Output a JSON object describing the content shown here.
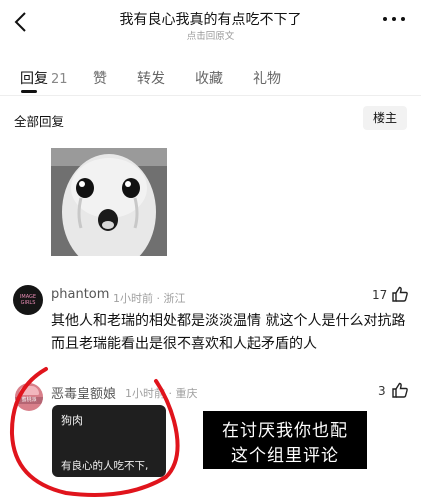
{
  "header": {
    "title": "我有良心我真的有点吃不下了",
    "subtitle": "点击回原文",
    "back_icon": "chevron-left-icon",
    "more_icon": "more-horizontal-icon"
  },
  "tabs": [
    {
      "label": "回复",
      "count": "21"
    },
    {
      "label": "赞"
    },
    {
      "label": "转发"
    },
    {
      "label": "收藏"
    },
    {
      "label": "礼物"
    }
  ],
  "section": {
    "label": "全部回复",
    "sort_label": "楼主"
  },
  "comments": [
    {
      "avatar_text": "IMAGE GIRLS",
      "author": "phantom",
      "meta": "1小时前 · 浙江",
      "likes": "17",
      "body": "其他人和老瑞的相处都是淡淡温情 就这个人是什么对抗路 而且老瑞能看出是很不喜欢和人起矛盾的人"
    },
    {
      "avatar_text": "蜜桃派",
      "author": "恶毒皇额娘",
      "meta": "1小时前 · 重庆",
      "likes": "3",
      "quote_title": "狗肉",
      "quote_snippet": "有良心的人吃不下,"
    }
  ],
  "overlay": {
    "line1": "在讨厌我你也配",
    "line2": "这个组里评论"
  },
  "colors": {
    "annotation_circle": "#e0141c",
    "overlay_bg": "#000000"
  }
}
